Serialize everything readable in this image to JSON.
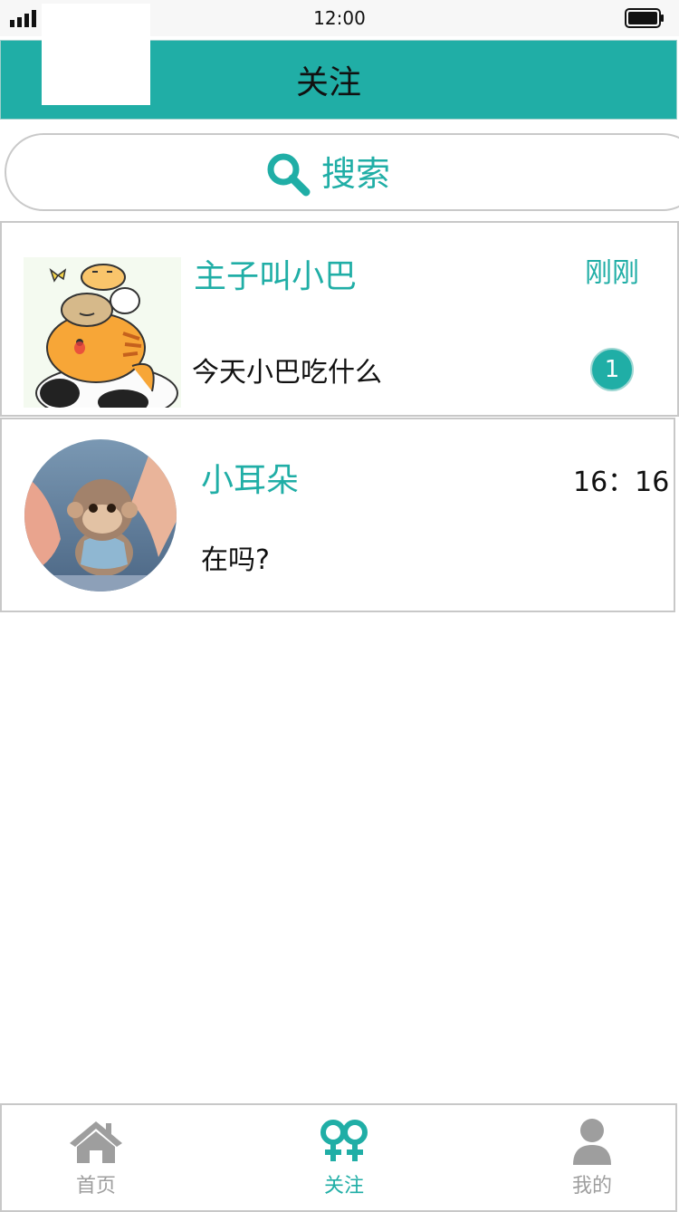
{
  "status_bar": {
    "time": "12:00"
  },
  "header": {
    "title": "关注"
  },
  "search": {
    "label": "搜索"
  },
  "chats": [
    {
      "name": "主子叫小巴",
      "time": "刚刚",
      "message": "今天小巴吃什么",
      "unread": "1"
    },
    {
      "name": "小耳朵",
      "time": "16：16",
      "message": "在吗?"
    }
  ],
  "tabs": [
    {
      "label": "首页",
      "icon": "home-icon",
      "active": false
    },
    {
      "label": "关注",
      "icon": "gender-couple-icon",
      "active": true
    },
    {
      "label": "我的",
      "icon": "user-icon",
      "active": false
    }
  ],
  "colors": {
    "accent": "#20aea6",
    "inactive": "#9e9e9e"
  }
}
